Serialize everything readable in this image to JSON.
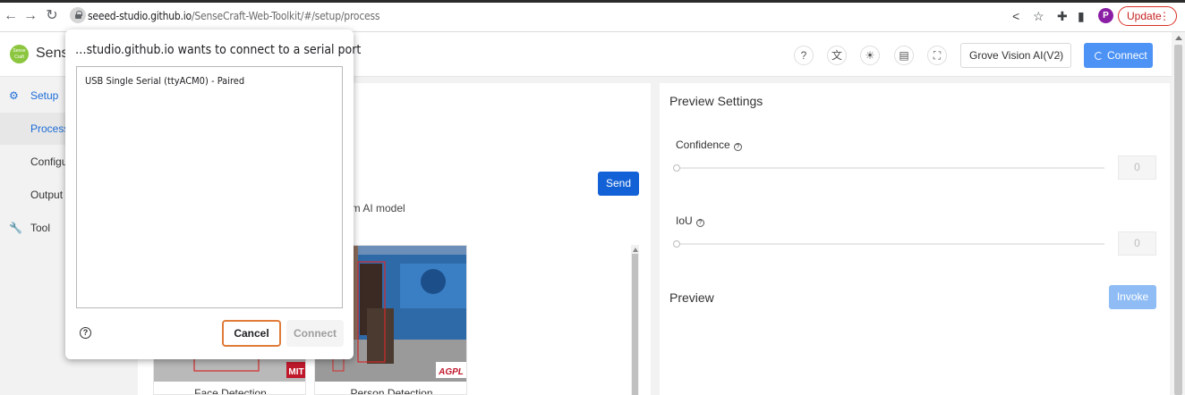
{
  "browser": {
    "url_host": "seeed-studio.github.io",
    "url_path": "/SenseCraft-Web-Toolkit/#/setup/process",
    "update_label": "Update",
    "profile_initial": "P"
  },
  "header": {
    "brand": "Sense",
    "logo_text": "Sense Craft",
    "device": "Grove Vision AI(V2)",
    "connect_label": "Connect"
  },
  "sidebar": {
    "items": [
      {
        "label": "Setup",
        "icon": "gear-icon"
      },
      {
        "label": "Process"
      },
      {
        "label": "Configura"
      },
      {
        "label": "Output"
      },
      {
        "label": "Tool",
        "icon": "wrench-icon"
      }
    ]
  },
  "main": {
    "send_label": "Send",
    "custom_model_text": "om AI model",
    "cards": [
      {
        "title": "Face Detection",
        "badge": "MIT"
      },
      {
        "title": "Person Detection",
        "badge": "AGPL"
      }
    ]
  },
  "preview_settings": {
    "title": "Preview Settings",
    "confidence_label": "Confidence",
    "confidence_value": "0",
    "iou_label": "IoU",
    "iou_value": "0",
    "preview_title": "Preview",
    "invoke_label": "Invoke"
  },
  "dialog": {
    "title": "…studio.github.io wants to connect to a serial port",
    "devices": [
      "USB Single Serial (ttyACM0) - Paired"
    ],
    "cancel_label": "Cancel",
    "connect_label": "Connect"
  },
  "colors": {
    "primary": "#1261d6",
    "connect_pending": "#4d93f5",
    "cancel_border": "#e07b39"
  }
}
